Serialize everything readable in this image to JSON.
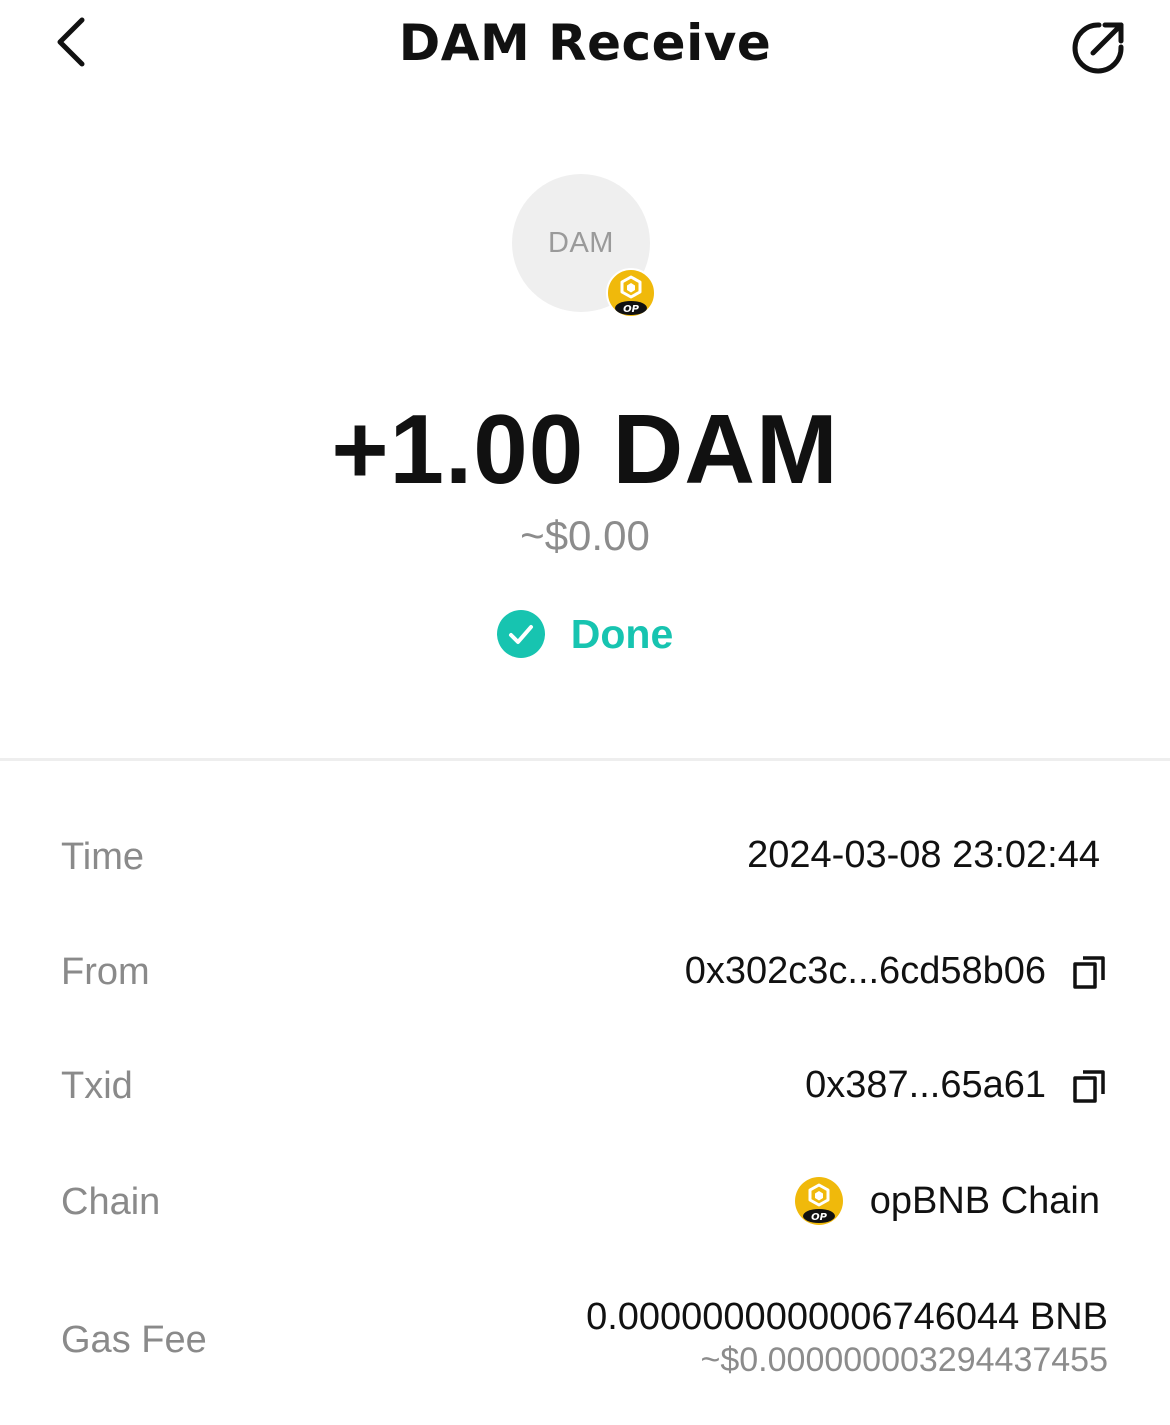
{
  "header": {
    "title": "DAM Receive"
  },
  "token": {
    "symbol": "DAM",
    "badge_label": "OP"
  },
  "transaction": {
    "amount": "+1.00 DAM",
    "fiat_value": "~$0.00",
    "status": "Done",
    "status_color": "#17c4b0"
  },
  "details": {
    "time_label": "Time",
    "time_value": "2024-03-08 23:02:44",
    "from_label": "From",
    "from_value": "0x302c3c...6cd58b06",
    "txid_label": "Txid",
    "txid_value": "0x387...65a61",
    "chain_label": "Chain",
    "chain_value": "opBNB Chain",
    "gas_label": "Gas Fee",
    "gas_value": "0.0000000000006746044 BNB",
    "gas_fiat": "~$0.000000003294437455"
  },
  "icons": {
    "back": "chevron-left-icon",
    "share": "share-icon",
    "copy": "copy-icon",
    "status": "check-circle-icon",
    "chain": "opbnb-logo-icon"
  }
}
